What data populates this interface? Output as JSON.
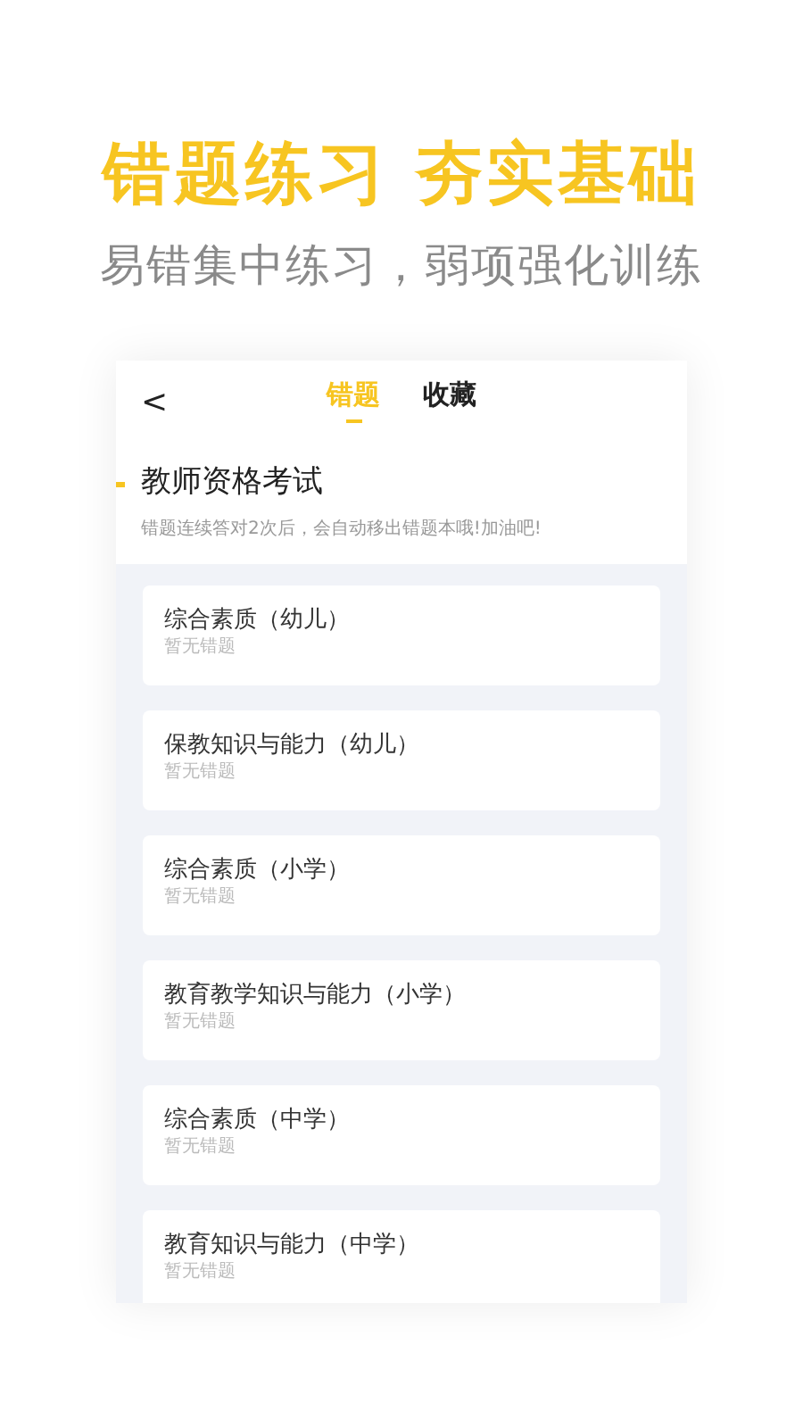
{
  "headline": "错题练习 夯实基础",
  "subheadline": "易错集中练习，弱项强化训练",
  "screen": {
    "back": "<",
    "tabs": [
      {
        "label": "错题",
        "selected": true
      },
      {
        "label": "收藏",
        "selected": false
      }
    ],
    "section_title": "教师资格考试",
    "section_hint": "错题连续答对2次后，会自动移出错题本哦!加油吧!",
    "subjects": [
      {
        "name": "综合素质（幼儿）",
        "status": "暂无错题"
      },
      {
        "name": "保教知识与能力（幼儿）",
        "status": "暂无错题"
      },
      {
        "name": "综合素质（小学）",
        "status": "暂无错题"
      },
      {
        "name": "教育教学知识与能力（小学）",
        "status": "暂无错题"
      },
      {
        "name": "综合素质（中学）",
        "status": "暂无错题"
      },
      {
        "name": "教育知识与能力（中学）",
        "status": "暂无错题"
      }
    ]
  }
}
